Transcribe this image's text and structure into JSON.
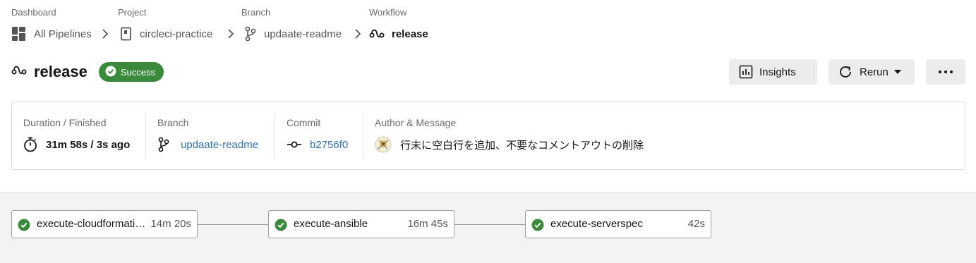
{
  "breadcrumb": {
    "labels": [
      "Dashboard",
      "Project",
      "Branch",
      "Workflow"
    ],
    "items": [
      {
        "text": "All Pipelines",
        "icon": "dashboard-grid-icon"
      },
      {
        "text": "circleci-practice",
        "icon": "repo-icon"
      },
      {
        "text": "updaate-readme",
        "icon": "branch-icon"
      },
      {
        "text": "release",
        "icon": "workflow-icon"
      }
    ]
  },
  "header": {
    "title": "release",
    "status": "Success",
    "insights_label": "Insights",
    "rerun_label": "Rerun",
    "more_label": "•••"
  },
  "details": {
    "duration_label": "Duration / Finished",
    "duration_value": "31m 58s / 3s ago",
    "branch_label": "Branch",
    "branch_value": "updaate-readme",
    "commit_label": "Commit",
    "commit_value": "b2756f0",
    "author_label": "Author & Message",
    "message": "行末に空白行を追加、不要なコメントアウトの削除"
  },
  "jobs": [
    {
      "name": "execute-cloudformation",
      "duration": "14m 20s",
      "status": "success"
    },
    {
      "name": "execute-ansible",
      "duration": "16m 45s",
      "status": "success"
    },
    {
      "name": "execute-serverspec",
      "duration": "42s",
      "status": "success"
    }
  ],
  "colors": {
    "success": "#3a8a3b",
    "link": "#2e6fb7",
    "button_bg": "#ececec",
    "canvas_bg": "#f3f3f3"
  }
}
